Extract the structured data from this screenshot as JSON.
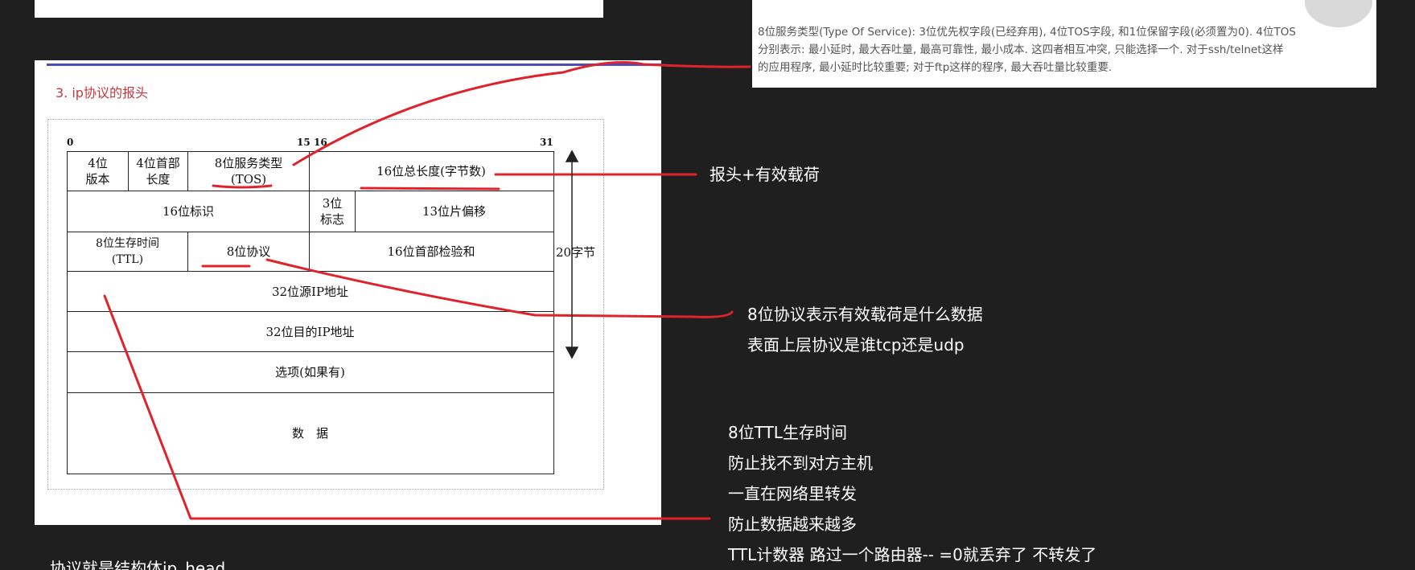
{
  "note": {
    "lines": [
      "8位服务类型(Type Of Service): 3位优先权字段(已经弃用), 4位TOS字段, 和1位保留字段(必须置为0). 4位TOS",
      "分别表示: 最小延时, 最大吞吐量, 最高可靠性, 最小成本. 这四者相互冲突, 只能选择一个. 对于ssh/telnet这样",
      "的应用程序, 最小延时比较重要; 对于ftp这样的程序, 最大吞吐量比较重要."
    ]
  },
  "card": {
    "title": "3. ip协议的报头"
  },
  "diagram": {
    "bit_labels": {
      "start": "0",
      "mid_a": "15",
      "mid_b": "16",
      "end": "31"
    },
    "rows": [
      {
        "cells": [
          "4位\n版本",
          "4位首部\n长度",
          "8位服务类型\n(TOS)",
          "16位总长度(字节数)"
        ]
      },
      {
        "cells": [
          "16位标识",
          "3位\n标志",
          "13位片偏移"
        ]
      },
      {
        "cells": [
          "8位生存时间\n(TTL)",
          "8位协议",
          "16位首部检验和"
        ]
      },
      {
        "cells": [
          "32位源IP地址"
        ]
      },
      {
        "cells": [
          "32位目的IP地址"
        ]
      },
      {
        "cells": [
          "选项(如果有)"
        ]
      },
      {
        "cells": [
          "数　据"
        ]
      }
    ],
    "side_label": "20字节"
  },
  "annotations": {
    "total_length": "报头+有效载荷",
    "protocol": [
      "8位协议表示有效载荷是什么数据",
      "表面上层协议是谁tcp还是udp"
    ],
    "ttl": [
      "8位TTL生存时间",
      "防止找不到对方主机",
      "一直在网络里转发",
      "防止数据越来越多",
      "TTL计数器 路过一个路由器-- =0就丢弃了 不转发了"
    ],
    "bottom_cut": "协议就是结构体ip_head"
  },
  "colors": {
    "ink": "#e0222b",
    "accent_bar": "#4b4fb3",
    "title": "#c6373d",
    "background": "#1f1f1f"
  }
}
